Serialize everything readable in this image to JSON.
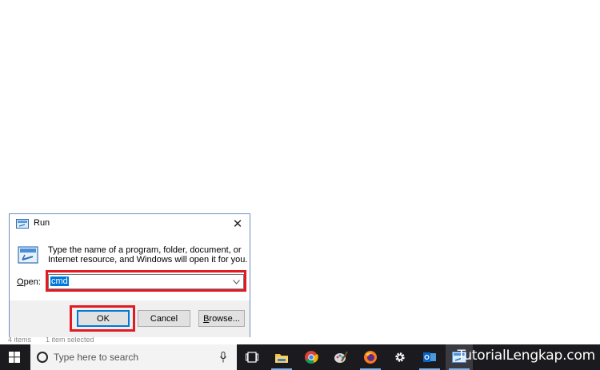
{
  "background": {
    "status_items_count": "4 items",
    "status_selected": "1 item selected"
  },
  "dialog": {
    "title": "Run",
    "description": "Type the name of a program, folder, document, or Internet resource, and Windows will open it for you.",
    "open_label_accesskey": "O",
    "open_label_rest": "pen:",
    "open_value": "cmd",
    "ok_label": "OK",
    "cancel_label": "Cancel",
    "browse_accesskey": "B",
    "browse_rest": "rowse...",
    "close_glyph": "✕"
  },
  "taskbar": {
    "search_placeholder": "Type here to search",
    "apps": [
      {
        "icon": "task-view-icon"
      },
      {
        "icon": "file-explorer-icon"
      },
      {
        "icon": "chrome-icon"
      },
      {
        "icon": "paint-icon"
      },
      {
        "icon": "firefox-icon"
      },
      {
        "icon": "settings-icon"
      },
      {
        "icon": "outlook-icon"
      },
      {
        "icon": "run-icon"
      }
    ],
    "brand": "TutorialLengkap.com"
  },
  "colors": {
    "highlight": "#e01b24",
    "accent": "#0078d7",
    "taskbar": "#1b1b1f"
  }
}
